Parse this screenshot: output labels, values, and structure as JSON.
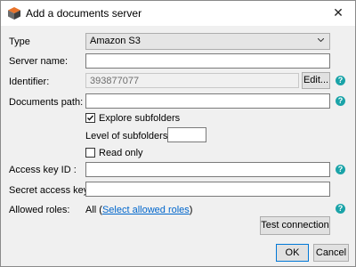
{
  "window": {
    "title": "Add a documents server",
    "app_icon": "cube-icon",
    "close_glyph": "✕"
  },
  "form": {
    "type_label": "Type",
    "type_value": "Amazon S3",
    "server_name_label": "Server name:",
    "server_name_value": "",
    "identifier_label": "Identifier:",
    "identifier_value": "393877077",
    "edit_label": "Edit...",
    "documents_path_label": "Documents path:",
    "documents_path_value": "",
    "explore_subfolders_label": "Explore subfolders",
    "explore_subfolders_checked": true,
    "level_label": "Level of subfolders:",
    "level_value": "",
    "read_only_label": "Read only",
    "read_only_checked": false,
    "access_key_label": "Access key ID :",
    "access_key_value": "",
    "secret_key_label": "Secret access key :",
    "secret_key_value": "",
    "allowed_roles_label": "Allowed roles:",
    "allowed_roles_prefix": "All (",
    "allowed_roles_link": "Select allowed roles",
    "allowed_roles_suffix": ")",
    "help_glyph": "?"
  },
  "buttons": {
    "test_connection": "Test connection",
    "ok": "OK",
    "cancel": "Cancel"
  },
  "colors": {
    "help_icon": "#1aa3a8",
    "link": "#0066cc",
    "default_button_border": "#0078d7"
  }
}
